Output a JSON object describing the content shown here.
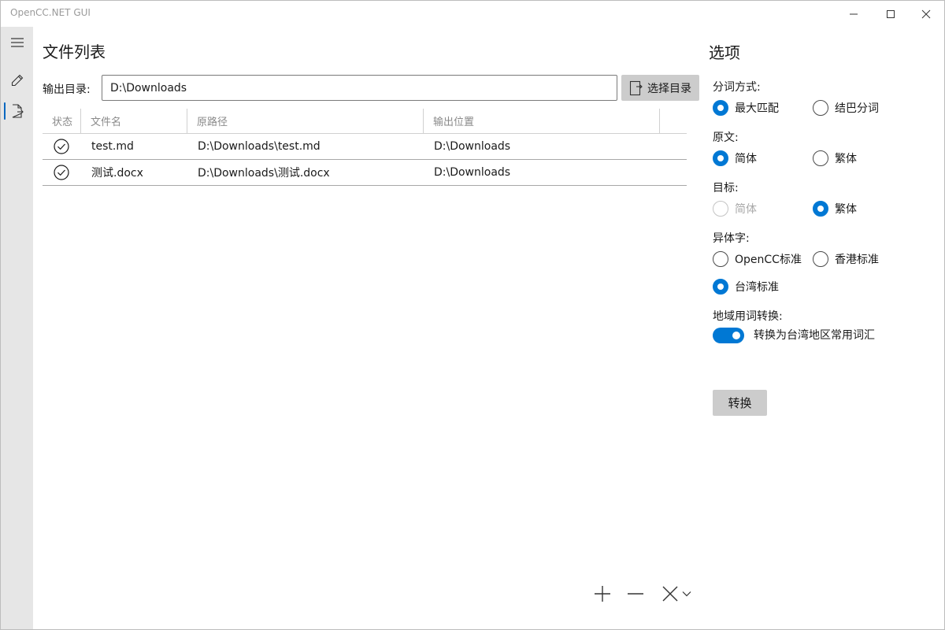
{
  "window": {
    "title": "OpenCC.NET GUI",
    "controls": [
      "minimize-icon",
      "maximize-icon",
      "close-icon"
    ]
  },
  "rail": {
    "items": [
      {
        "icon": "hamburger-menu-icon"
      },
      {
        "icon": "pencil-icon"
      },
      {
        "icon": "document-export-icon",
        "active": true
      }
    ]
  },
  "main": {
    "title": "文件列表",
    "output_label": "输出目录:",
    "output_value": "D:\\Downloads",
    "choose_button": "选择目录",
    "columns": [
      "状态",
      "文件名",
      "原路径",
      "输出位置"
    ],
    "rows": [
      {
        "status": "check-circle-icon",
        "name": "test.md",
        "source": "D:\\Downloads\\test.md",
        "output": "D:\\Downloads"
      },
      {
        "status": "check-circle-icon",
        "name": "测试.docx",
        "source": "D:\\Downloads\\测试.docx",
        "output": "D:\\Downloads"
      }
    ],
    "commands": [
      "add-icon",
      "remove-icon",
      "clear-icon",
      "chevron-down-icon"
    ]
  },
  "options": {
    "title": "选项",
    "segmentation": {
      "label": "分词方式:",
      "choices": [
        "最大匹配",
        "结巴分词"
      ],
      "selected": "最大匹配"
    },
    "source": {
      "label": "原文:",
      "choices": [
        "简体",
        "繁体"
      ],
      "selected": "简体"
    },
    "target": {
      "label": "目标:",
      "choices": [
        "简体",
        "繁体"
      ],
      "selected": "繁体",
      "disabled": [
        "简体"
      ]
    },
    "variant": {
      "label": "异体字:",
      "choices": [
        "OpenCC标准",
        "香港标准",
        "台湾标准"
      ],
      "selected": "台湾标准"
    },
    "regional": {
      "label": "地域用词转换:",
      "toggle_on": true,
      "toggle_text": "转换为台湾地区常用词汇"
    },
    "convert_button": "转换"
  },
  "colors": {
    "accent": "#0078d4",
    "rail": "#e6e6e6",
    "button": "#cccccc"
  }
}
